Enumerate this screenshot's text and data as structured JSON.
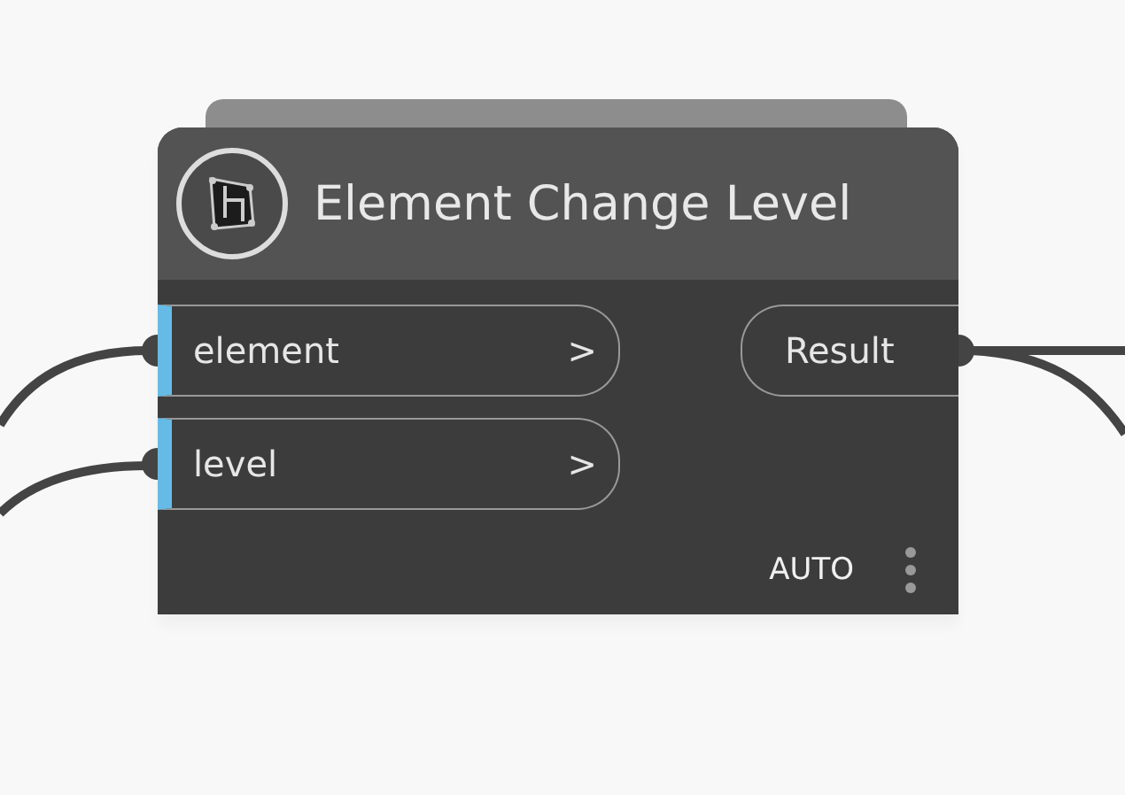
{
  "node": {
    "title": "Element Change Level",
    "inputs": [
      {
        "label": "element",
        "arrow": ">"
      },
      {
        "label": "level",
        "arrow": ">"
      }
    ],
    "outputs": [
      {
        "label": "Result"
      }
    ],
    "run_mode": "AUTO"
  }
}
